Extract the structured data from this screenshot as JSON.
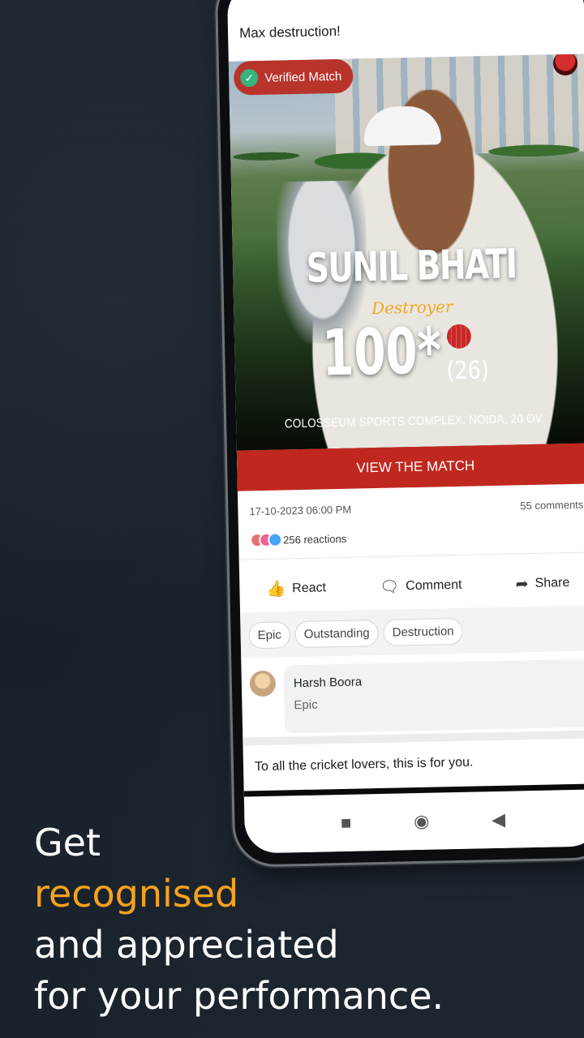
{
  "post": {
    "caption": "Max destruction!",
    "verified_label": "Verified Match",
    "player_name": "SUNIL BHATI",
    "player_title": "Destroyer",
    "score": "100*",
    "balls": "(26)",
    "venue": "COLOSSEUM SPORTS COMPLEX, NOIDA, 20 OV.",
    "view_button": "VIEW THE MATCH",
    "date": "17-10-2023 06:00 PM",
    "comments_count": "55 comments",
    "reactions_count": "256 reactions",
    "actions": {
      "react": "React",
      "comment": "Comment",
      "share": "Share"
    },
    "tags": [
      "Epic",
      "Outstanding",
      "Destruction"
    ],
    "comment": {
      "author": "Harsh Boora",
      "text": "Epic"
    },
    "next_caption": "To all the cricket lovers, this is for you."
  },
  "marketing": {
    "line1": "Get",
    "line2": "recognised",
    "line3": "and appreciated",
    "line4": "for your performance."
  },
  "icons": {
    "verified": "check-circle-icon",
    "react": "thumbs-up-icon",
    "comment": "comment-icon",
    "share": "share-icon",
    "nav_recent": "square-icon",
    "nav_home": "circle-icon",
    "nav_back": "triangle-back-icon"
  },
  "colors": {
    "accent": "#f7a21b",
    "primary_red": "#c0281f",
    "background": "#1b232b",
    "verified_green": "#36b37e"
  }
}
